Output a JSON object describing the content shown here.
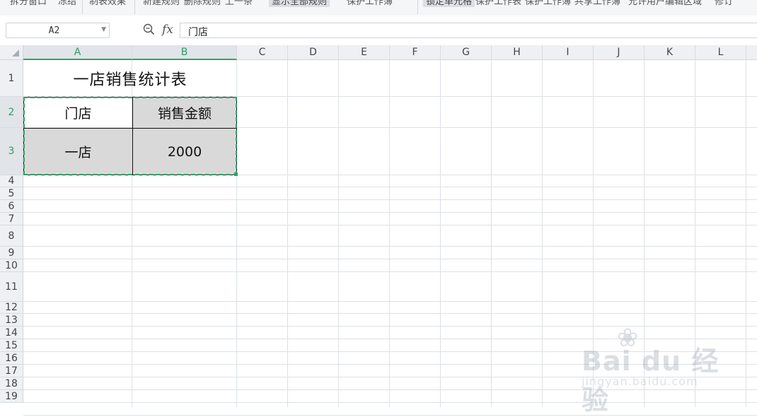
{
  "ribbon": {
    "items": [
      {
        "label": "拆分窗口",
        "hl": false
      },
      {
        "label": "冻结",
        "hl": false
      },
      {
        "label": "制表效果",
        "hl": false
      },
      {
        "label": "新建规则",
        "hl": false
      },
      {
        "label": "删除规则",
        "hl": false
      },
      {
        "label": "上一条",
        "hl": false
      },
      {
        "label": "显示全部规则",
        "hl": true
      },
      {
        "label": "保护工作簿",
        "hl": false
      },
      {
        "label": "锁定单元格",
        "hl": true
      },
      {
        "label": "保护工作表",
        "hl": false
      },
      {
        "label": "保护工作簿",
        "hl": false
      },
      {
        "label": "共享工作簿",
        "hl": false
      },
      {
        "label": "允许用户编辑区域",
        "hl": false
      },
      {
        "label": "修订",
        "hl": false
      }
    ]
  },
  "formula_bar": {
    "name_box": "A2",
    "zoom_icon": "zoom-icon",
    "fx_label": "fx",
    "content": "门店"
  },
  "sheet": {
    "columns": [
      "A",
      "B",
      "C",
      "D",
      "E",
      "F",
      "G",
      "H",
      "I",
      "J",
      "K",
      "L"
    ],
    "selected_columns": [
      "A",
      "B"
    ],
    "rows": [
      "1",
      "2",
      "3",
      "4",
      "5",
      "6",
      "7",
      "8",
      "9",
      "10",
      "11",
      "12",
      "13",
      "14",
      "15",
      "16",
      "17",
      "18",
      "19"
    ],
    "selected_rows": [
      "2",
      "3"
    ],
    "cells": {
      "title": "一店销售统计表",
      "a2": "门店",
      "b2": "销售金额",
      "a3": "一店",
      "b3": "2000"
    }
  },
  "watermark": {
    "logo": "Bai du 经验",
    "url": "jingyan.baidu.com"
  },
  "colors": {
    "selection": "#2fa36b",
    "cell_fill": "#d9d9d9",
    "header_bg": "#eef0f3"
  }
}
